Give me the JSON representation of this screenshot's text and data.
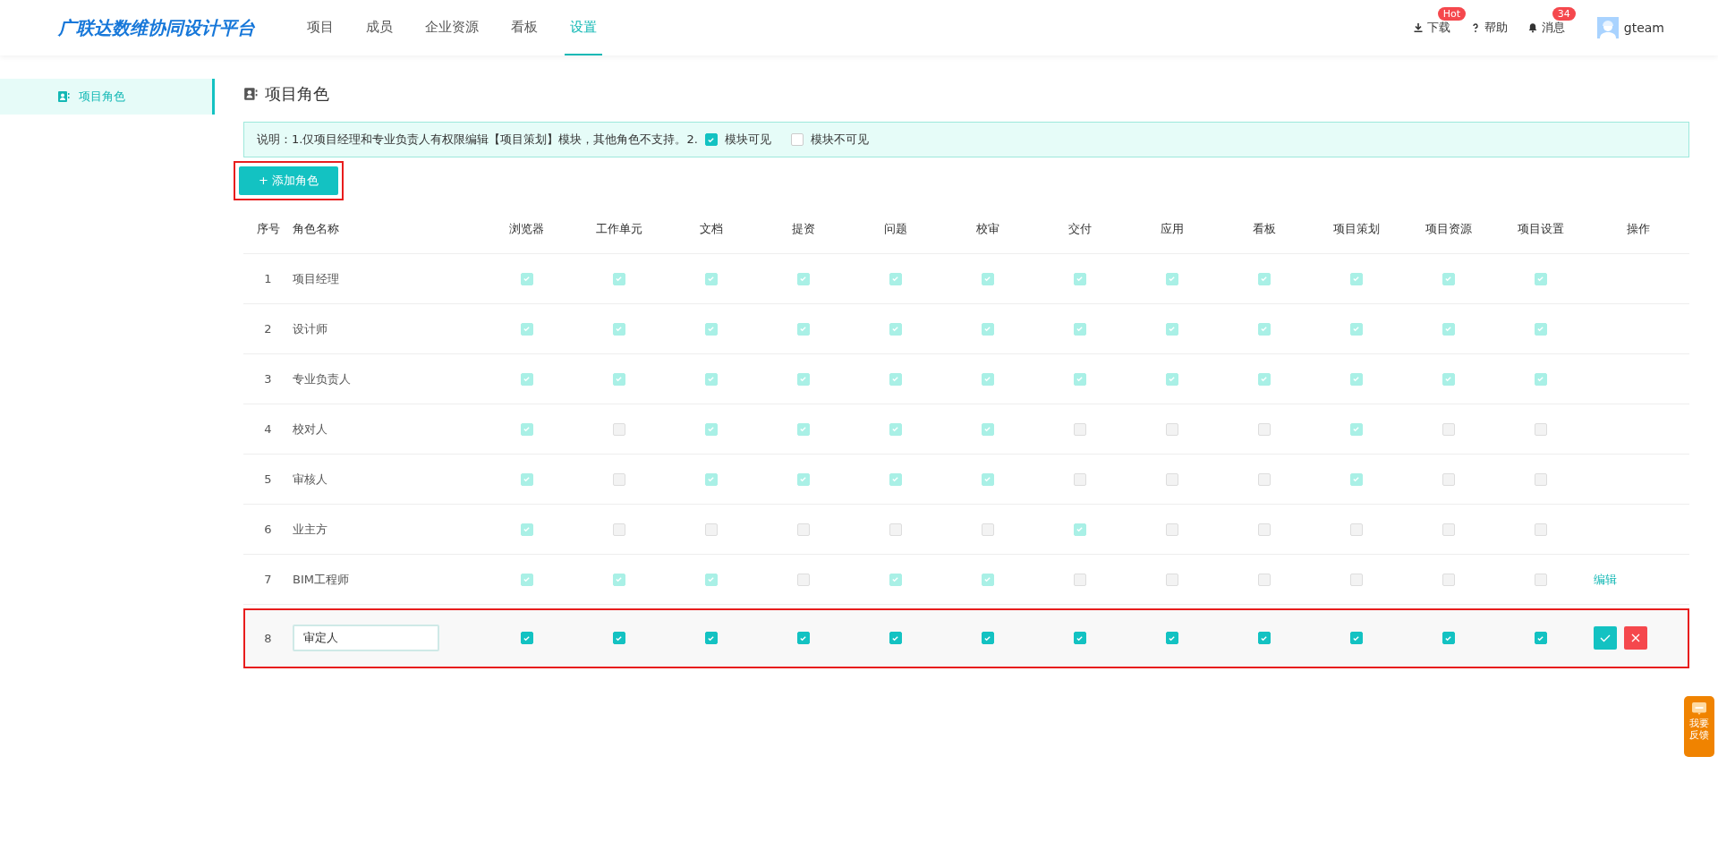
{
  "header": {
    "logo": "广联达数维协同设计平台",
    "nav": [
      {
        "label": "项目",
        "selected": false
      },
      {
        "label": "成员",
        "selected": false
      },
      {
        "label": "企业资源",
        "selected": false
      },
      {
        "label": "看板",
        "selected": false
      },
      {
        "label": "设置",
        "selected": true
      }
    ],
    "tools": [
      {
        "kind": "download",
        "label": "下载",
        "badge": "Hot"
      },
      {
        "kind": "help",
        "label": "帮助"
      },
      {
        "kind": "messages",
        "label": "消息",
        "badge": "34"
      }
    ],
    "user": "gteam"
  },
  "sidebar": {
    "items": [
      {
        "label": "项目角色",
        "selected": true
      }
    ]
  },
  "page_title": "项目角色",
  "notice": {
    "text": "说明：1.仅项目经理和专业负责人有权限编辑【项目策划】模块，其他角色不支持。2.",
    "legend": [
      {
        "label": "模块可见",
        "checked": true
      },
      {
        "label": "模块不可见",
        "checked": false
      }
    ]
  },
  "add_button": {
    "label": "+ 添加角色",
    "highlighted": true
  },
  "table": {
    "columns": [
      "序号",
      "角色名称",
      "浏览器",
      "工作单元",
      "文档",
      "提资",
      "问题",
      "校审",
      "交付",
      "应用",
      "看板",
      "项目策划",
      "项目资源",
      "项目设置",
      "操作"
    ],
    "rows": [
      {
        "index": "1",
        "name": "项目经理",
        "editing": false,
        "highlighted": false,
        "perms": [
          true,
          true,
          true,
          true,
          true,
          true,
          true,
          true,
          true,
          true,
          true,
          true
        ]
      },
      {
        "index": "2",
        "name": "设计师",
        "editing": false,
        "highlighted": false,
        "perms": [
          true,
          true,
          true,
          true,
          true,
          true,
          true,
          true,
          true,
          true,
          true,
          true
        ]
      },
      {
        "index": "3",
        "name": "专业负责人",
        "editing": false,
        "highlighted": false,
        "perms": [
          true,
          true,
          true,
          true,
          true,
          true,
          true,
          true,
          true,
          true,
          true,
          true
        ]
      },
      {
        "index": "4",
        "name": "校对人",
        "editing": false,
        "highlighted": false,
        "perms": [
          true,
          false,
          true,
          true,
          true,
          true,
          false,
          false,
          false,
          true,
          false,
          false
        ]
      },
      {
        "index": "5",
        "name": "审核人",
        "editing": false,
        "highlighted": false,
        "perms": [
          true,
          false,
          true,
          true,
          true,
          true,
          false,
          false,
          false,
          true,
          false,
          false
        ]
      },
      {
        "index": "6",
        "name": "业主方",
        "editing": false,
        "highlighted": false,
        "perms": [
          true,
          false,
          false,
          false,
          false,
          false,
          true,
          false,
          false,
          false,
          false,
          false
        ]
      },
      {
        "index": "7",
        "name": "BIM工程师",
        "editing": false,
        "highlighted": false,
        "action": "编辑",
        "perms": [
          true,
          true,
          true,
          false,
          true,
          true,
          false,
          false,
          false,
          false,
          false,
          false
        ]
      },
      {
        "index": "8",
        "name": "审定人",
        "editing": true,
        "highlighted": true,
        "perms": [
          true,
          true,
          true,
          true,
          true,
          true,
          true,
          true,
          true,
          true,
          true,
          true
        ]
      }
    ]
  },
  "feedback": {
    "label": "我要反馈"
  }
}
